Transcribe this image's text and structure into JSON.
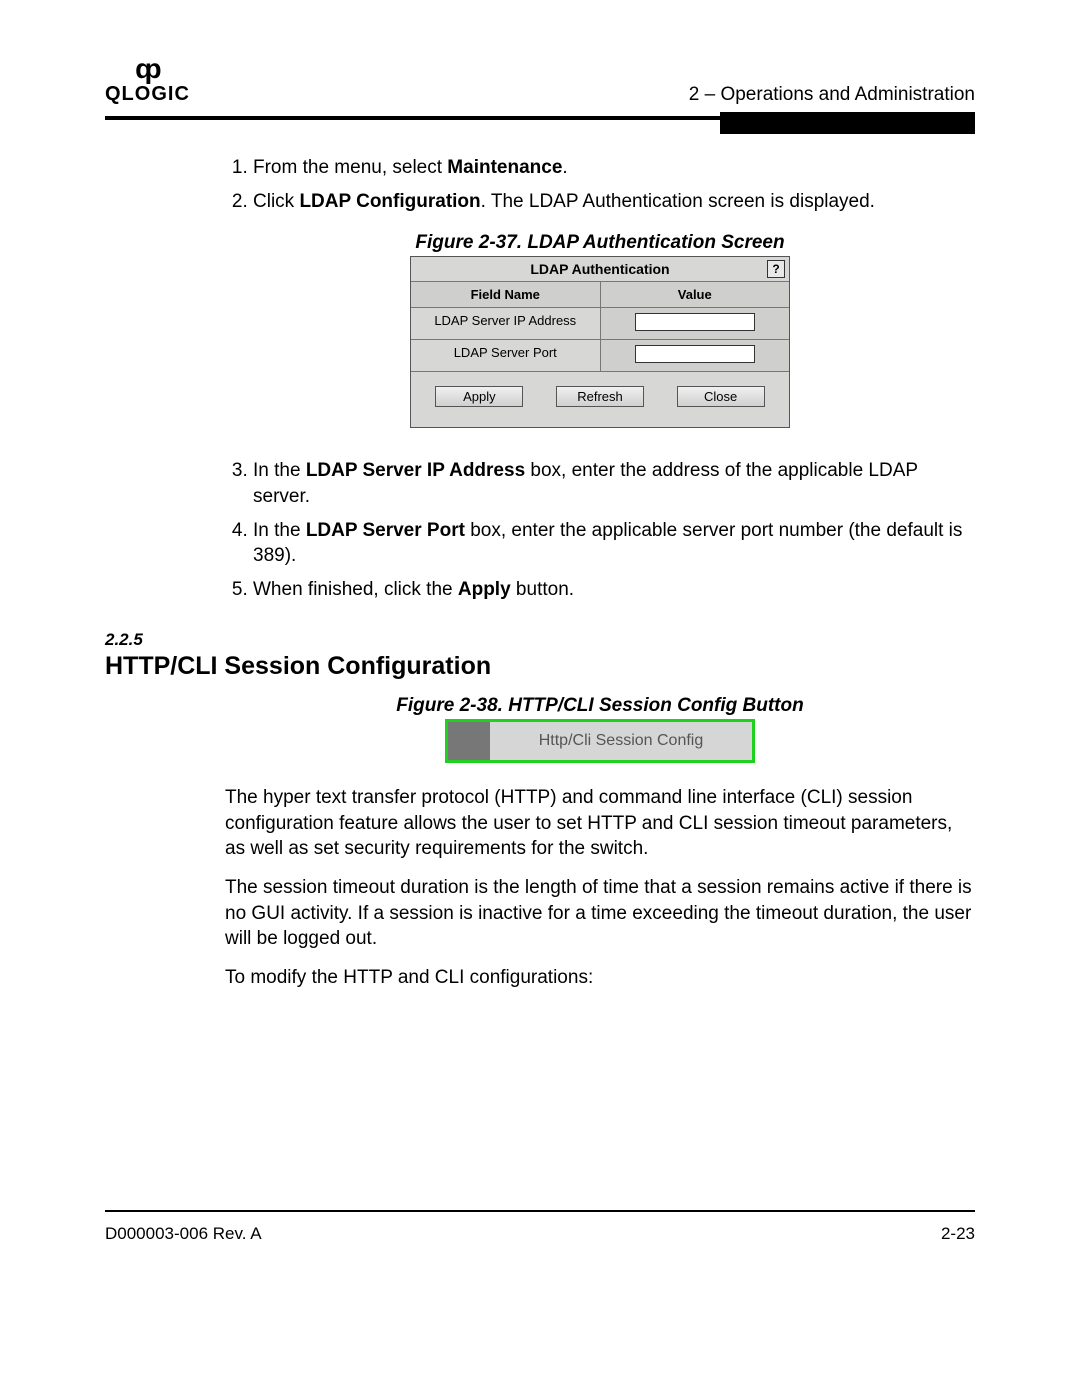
{
  "header": {
    "logo_text": "QLOGIC",
    "section_marker": "2 – Operations and Administration"
  },
  "steps_a": [
    {
      "pre": "From the menu, select ",
      "bold": "Maintenance",
      "post": "."
    },
    {
      "pre": "Click ",
      "bold": "LDAP Configuration",
      "post": ". The LDAP Authentication screen is displayed."
    }
  ],
  "figure37": {
    "caption": "Figure 2-37. LDAP Authentication Screen",
    "dialog_title": "LDAP Authentication",
    "help": "?",
    "col_field": "Field Name",
    "col_value": "Value",
    "rows": [
      {
        "label": "LDAP Server IP Address"
      },
      {
        "label": "LDAP Server Port"
      }
    ],
    "buttons": {
      "apply": "Apply",
      "refresh": "Refresh",
      "close": "Close"
    }
  },
  "steps_b": [
    {
      "pre": "In the ",
      "bold": "LDAP Server IP Address",
      "post": " box, enter the address of the applicable LDAP server."
    },
    {
      "pre": "In the ",
      "bold": "LDAP Server Port",
      "post": " box, enter the applicable server port number (the default is 389)."
    },
    {
      "pre": "When finished, click the ",
      "bold": "Apply",
      "post": " button."
    }
  ],
  "section": {
    "number": "2.2.5",
    "title": "HTTP/CLI Session Configuration"
  },
  "figure38": {
    "caption": "Figure 2-38. HTTP/CLI Session Config Button",
    "button_label": "Http/Cli Session Config"
  },
  "paragraphs": {
    "p1": "The hyper text transfer protocol (HTTP) and command line interface (CLI) session configuration feature allows the user to set HTTP and CLI session timeout parameters, as well as set security requirements for the switch.",
    "p2": "The session timeout duration is the length of time that a session remains active if there is no GUI activity. If a session is inactive for a time exceeding the timeout duration, the user will be logged out.",
    "p3": "To modify the HTTP and CLI configurations:"
  },
  "footer": {
    "left": "D000003-006 Rev. A",
    "right": "2-23"
  }
}
